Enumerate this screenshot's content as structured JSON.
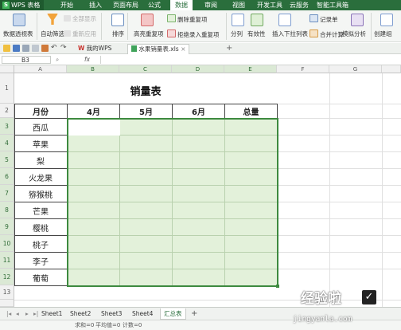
{
  "app": {
    "name": "WPS 表格",
    "logo_letter": "S"
  },
  "menu": {
    "tabs": [
      "开始",
      "插入",
      "页面布局",
      "公式",
      "数据",
      "审阅",
      "视图",
      "开发工具",
      "云服务",
      "智能工具箱"
    ],
    "active": "数据"
  },
  "ribbon": {
    "pivot": "数据透视表",
    "autofilter": "自动筛选",
    "show_all": "全部显示",
    "reapply": "重新应用",
    "sort": "排序",
    "highlight_dup": "高亮重复项",
    "remove_dup": "删除重复项",
    "reject_dup": "拒绝录入重复项",
    "split": "分列",
    "validity": "有效性",
    "insert_dropdown": "插入下拉列表",
    "record_form": "记录单",
    "consolidate": "合并计算",
    "simulate": "模拟分析",
    "create_group": "创建组"
  },
  "doc_tabs": {
    "home": "我的WPS",
    "file": "水果销量表.xls"
  },
  "formula_bar": {
    "cell_ref": "B3",
    "fx": "fx",
    "value": ""
  },
  "grid": {
    "columns": [
      "A",
      "B",
      "C",
      "D",
      "E",
      "F",
      "G"
    ],
    "rows": [
      "1",
      "2",
      "3",
      "4",
      "5",
      "6",
      "7",
      "8",
      "9",
      "10",
      "11",
      "12",
      "13"
    ]
  },
  "sheet": {
    "title": "销量表",
    "headers": [
      "月份",
      "4月",
      "5月",
      "6月",
      "总量"
    ],
    "fruits": [
      "西瓜",
      "苹果",
      "梨",
      "火龙果",
      "猕猴桃",
      "芒果",
      "樱桃",
      "桃子",
      "李子",
      "葡萄"
    ]
  },
  "sheet_tabs": [
    "Sheet1",
    "Sheet2",
    "Sheet3",
    "Sheet4",
    "汇总表"
  ],
  "active_sheet": "汇总表",
  "status": {
    "sum": "求和=0",
    "avg": "平均值=0",
    "count": "计数=0"
  },
  "watermark": {
    "text": "经验啦",
    "check": "✓",
    "url": "jingyanla.com"
  },
  "colors": {
    "brand": "#2a6e3c",
    "selection_fill": "#e3f1da",
    "selected_header": "#dbe9d5"
  }
}
